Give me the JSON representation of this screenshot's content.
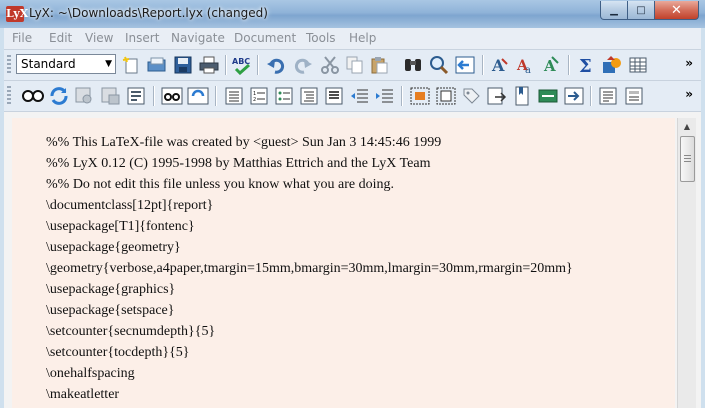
{
  "window": {
    "title": "LyX: ~\\Downloads\\Report.lyx (changed)",
    "app_icon_text": "LyX",
    "close_glyph": "✕",
    "minimize_glyph": "▁",
    "maximize_glyph": "□"
  },
  "menu": [
    "File",
    "Edit",
    "View",
    "Insert",
    "Navigate",
    "Document",
    "Tools",
    "Help"
  ],
  "toolbar": {
    "paragraph_style": "Standard",
    "overflow_glyph": "»",
    "row1_icons": [
      "new-document-icon",
      "open-folder-icon",
      "save-icon",
      "print-icon",
      "spellcheck-icon",
      "undo-icon",
      "redo-icon",
      "cut-icon",
      "copy-icon",
      "paste-icon",
      "find-icon",
      "zoom-icon",
      "navigate-back-icon",
      "text-style-icon",
      "character-icon",
      "math-mode-icon",
      "sum-icon",
      "insert-graphics-icon",
      "insert-table-icon"
    ],
    "row2_icons": [
      "view-icon",
      "update-icon",
      "view-dvi-icon",
      "view-pdf-icon",
      "export-icon",
      "compare-icon",
      "refresh-icon",
      "list-icon",
      "numbered-list-icon",
      "description-icon",
      "outline-icon",
      "bullet-icon",
      "indent-decrease-icon",
      "indent-increase-icon",
      "note-icon",
      "float-icon",
      "label-icon",
      "reference-icon",
      "bookmark-icon",
      "index-icon",
      "box-icon",
      "toc-icon",
      "document-settings-icon"
    ]
  },
  "document": {
    "lines": [
      "%% This LaTeX-file was created by <guest> Sun Jan 3 14:45:46 1999",
      "%% LyX 0.12 (C) 1995-1998 by Matthias Ettrich and the LyX Team",
      "%% Do not edit this file unless you know what you are doing.",
      "\\documentclass[12pt]{report}",
      "\\usepackage[T1]{fontenc}",
      "\\usepackage{geometry}",
      "\\geometry{verbose,a4paper,tmargin=15mm,bmargin=30mm,lmargin=30mm,rmargin=20mm}",
      "\\usepackage{graphics}",
      "\\usepackage{setspace}",
      "\\setcounter{secnumdepth}{5}",
      "\\setcounter{tocdepth}{5}",
      "\\onehalfspacing",
      "\\makeatletter"
    ]
  },
  "colors": {
    "editor_background": "#fcefe8",
    "titlebar": "#8fb3d8",
    "close_button": "#c1412b"
  }
}
